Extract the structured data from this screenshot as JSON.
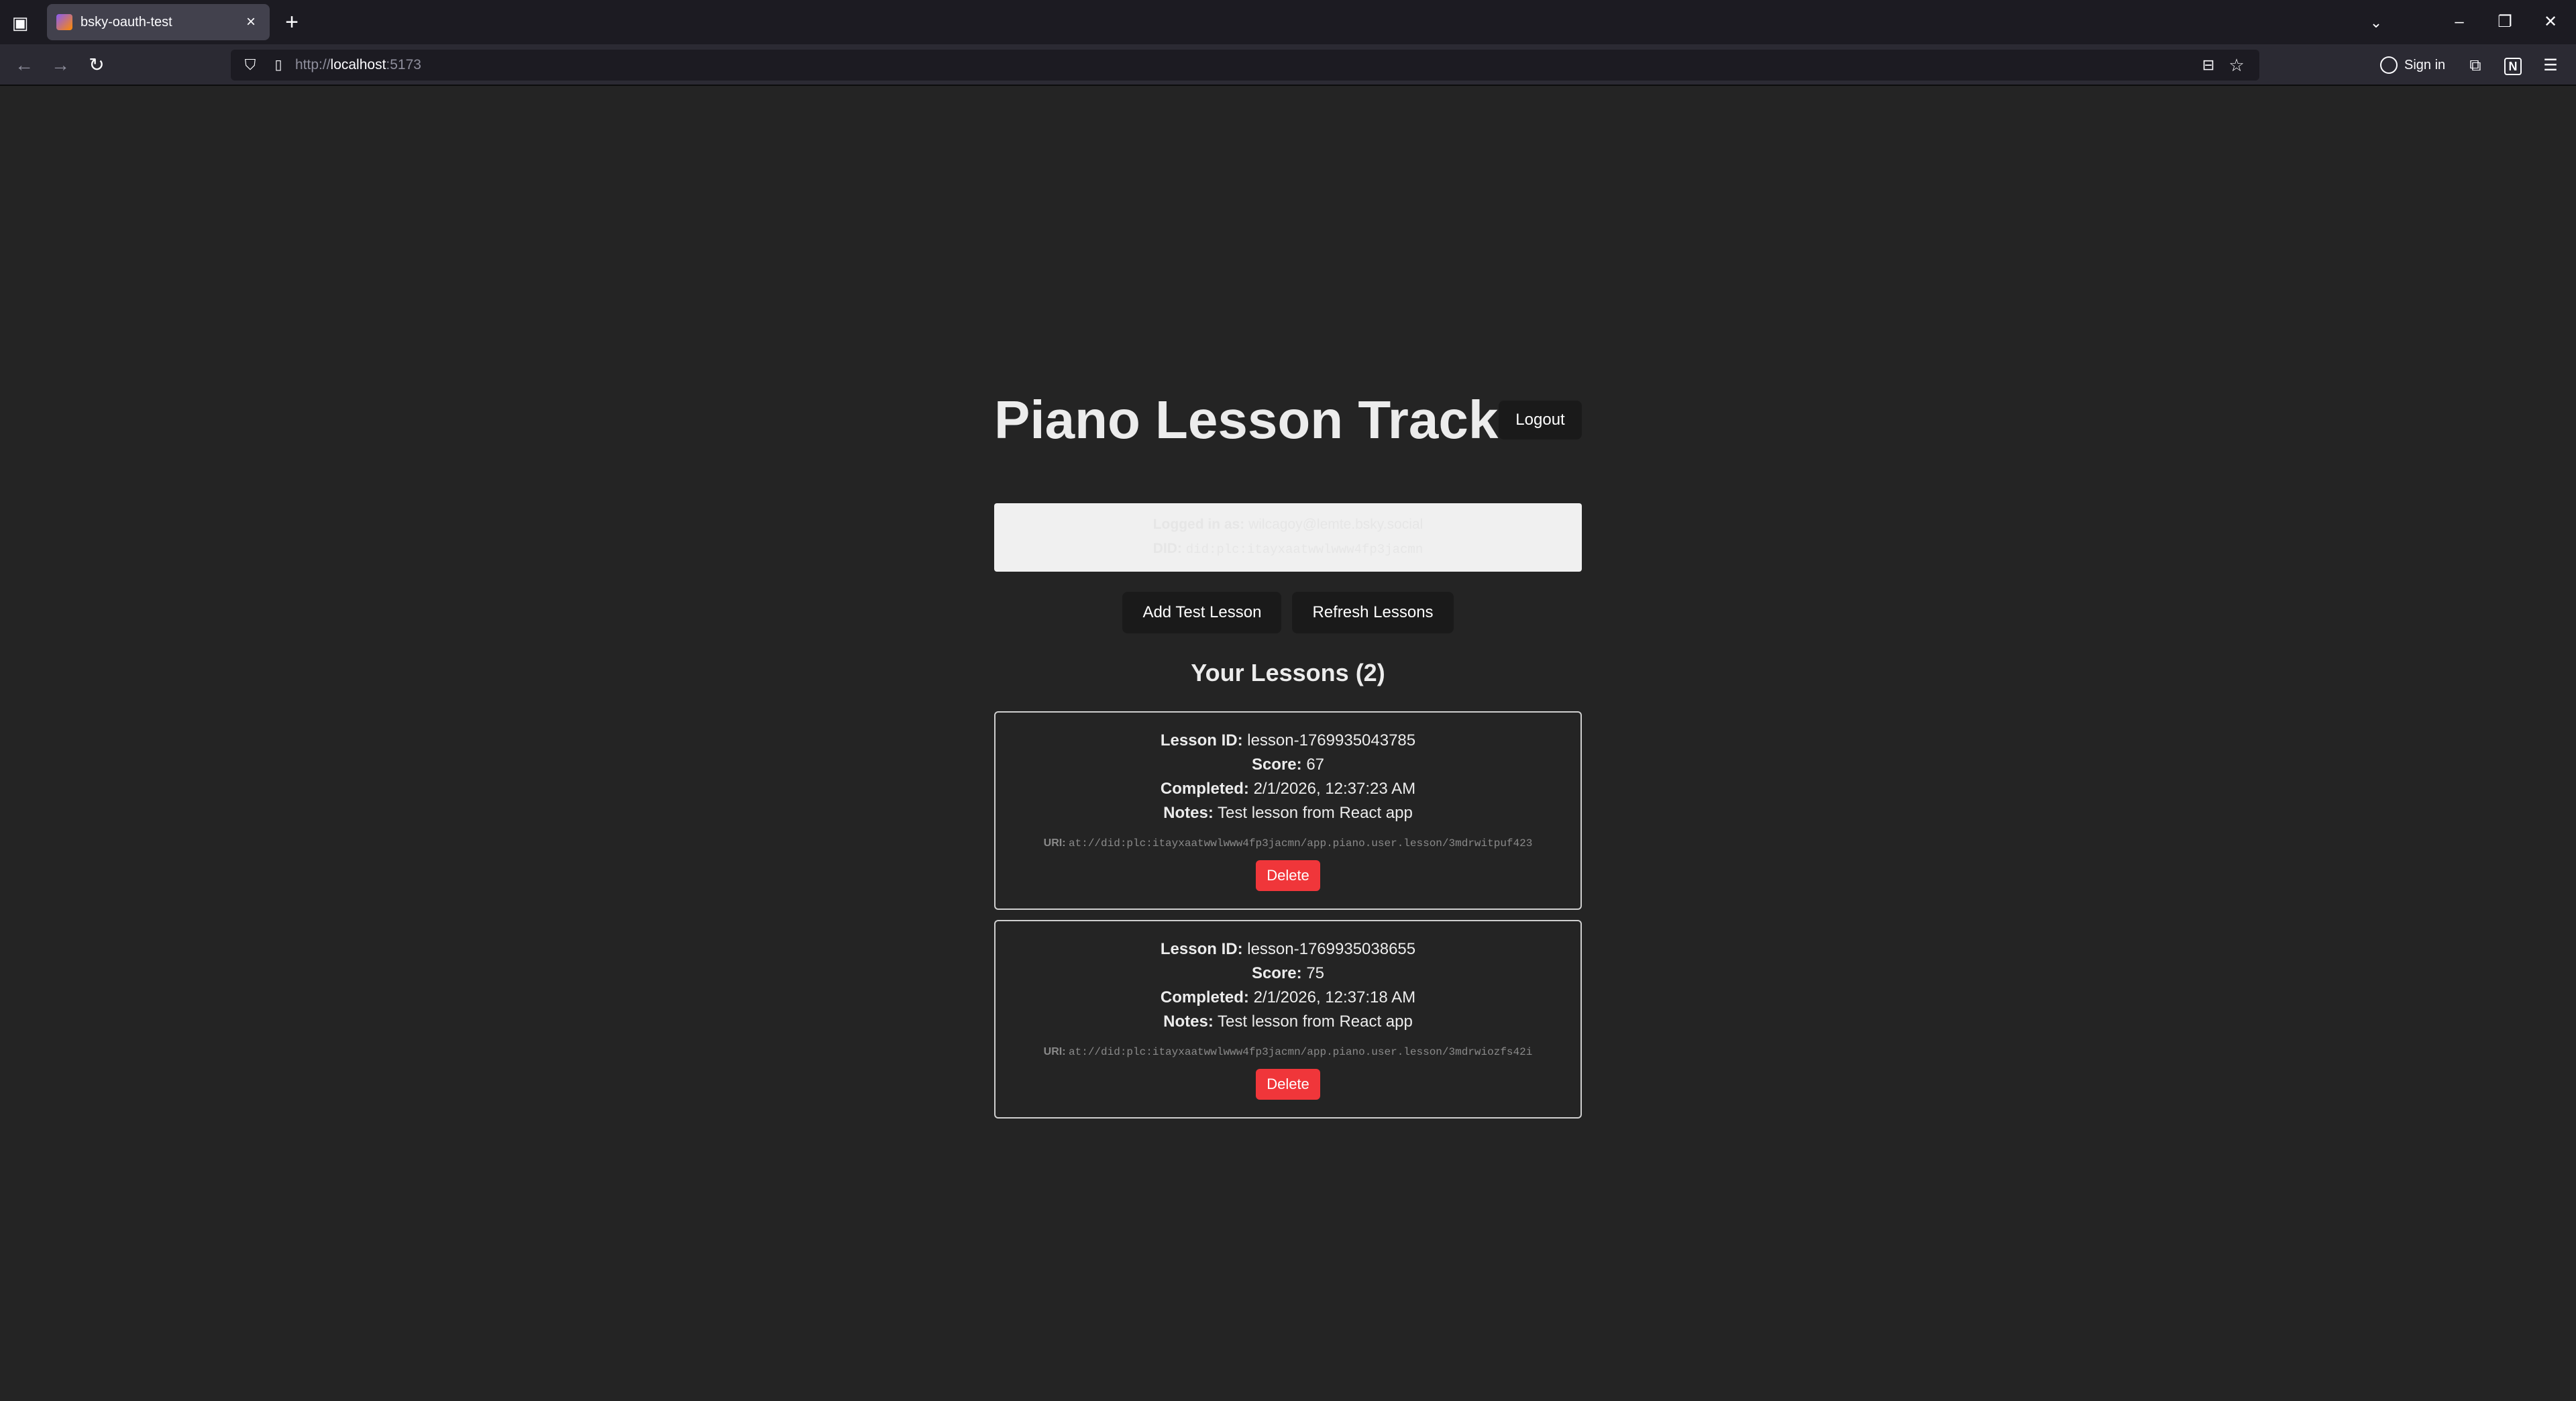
{
  "browser": {
    "tab_title": "bsky-oauth-test",
    "url_prefix": "http://",
    "url_host": "localhost",
    "url_port": ":5173",
    "signin_label": "Sign in",
    "new_tab_symbol": "+",
    "tab_close_symbol": "×"
  },
  "app": {
    "title": "Piano Lesson Tracker",
    "logout_label": "Logout",
    "user": {
      "logged_in_label": "Logged in as:",
      "handle": "wilcagoy@lemte.bsky.social",
      "did_label": "DID:",
      "did": "did:plc:itayxaatwwlwww4fp3jacmn"
    },
    "actions": {
      "add_label": "Add Test Lesson",
      "refresh_label": "Refresh Lessons"
    },
    "lessons_heading": "Your Lessons (2)",
    "labels": {
      "lesson_id": "Lesson ID:",
      "score": "Score:",
      "completed": "Completed:",
      "notes": "Notes:",
      "uri": "URI:",
      "delete": "Delete"
    },
    "lessons": [
      {
        "id": "lesson-1769935043785",
        "score": "67",
        "completed": "2/1/2026, 12:37:23 AM",
        "notes": "Test lesson from React app",
        "uri": "at://did:plc:itayxaatwwlwww4fp3jacmn/app.piano.user.lesson/3mdrwitpuf423"
      },
      {
        "id": "lesson-1769935038655",
        "score": "75",
        "completed": "2/1/2026, 12:37:18 AM",
        "notes": "Test lesson from React app",
        "uri": "at://did:plc:itayxaatwwlwww4fp3jacmn/app.piano.user.lesson/3mdrwiozfs42i"
      }
    ]
  }
}
